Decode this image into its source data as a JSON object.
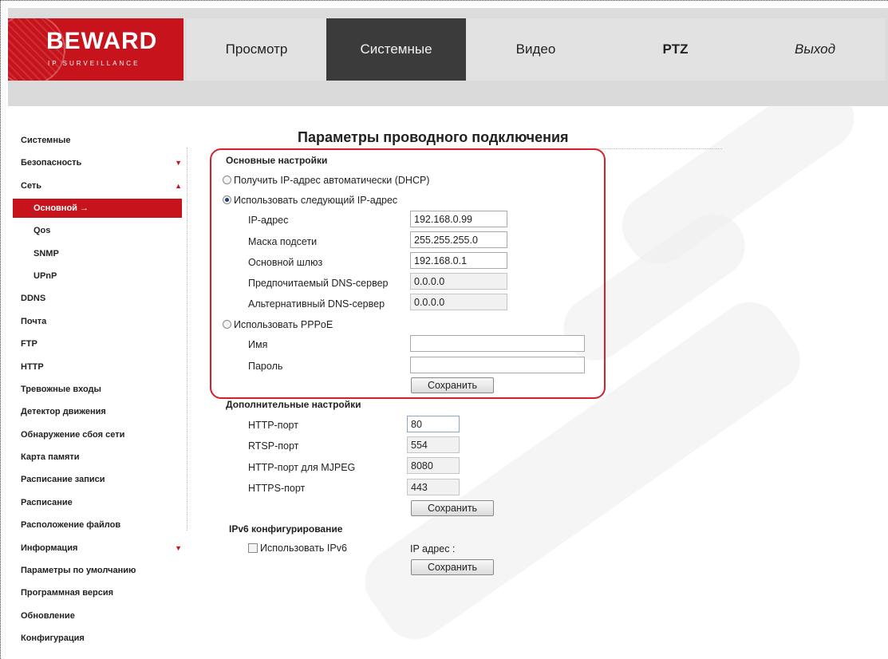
{
  "logo": {
    "brand": "BEWARD",
    "tagline": "IP SURVEILLANCE"
  },
  "nav": {
    "tabs": [
      {
        "label": "Просмотр"
      },
      {
        "label": "Системные"
      },
      {
        "label": "Видео"
      },
      {
        "label": "PTZ"
      },
      {
        "label": "Выход"
      }
    ]
  },
  "sidebar": {
    "items": [
      {
        "label": "Системные"
      },
      {
        "label": "Безопасность"
      },
      {
        "label": "Сеть"
      },
      {
        "label": "Основной"
      },
      {
        "label": "Qos"
      },
      {
        "label": "SNMP"
      },
      {
        "label": "UPnP"
      },
      {
        "label": "DDNS"
      },
      {
        "label": "Почта"
      },
      {
        "label": "FTP"
      },
      {
        "label": "HTTP"
      },
      {
        "label": "Тревожные входы"
      },
      {
        "label": "Детектор движения"
      },
      {
        "label": "Обнаружение сбоя сети"
      },
      {
        "label": "Карта памяти"
      },
      {
        "label": "Расписание записи"
      },
      {
        "label": "Расписание"
      },
      {
        "label": "Расположение файлов"
      },
      {
        "label": "Информация"
      },
      {
        "label": "Параметры по умолчанию"
      },
      {
        "label": "Программная версия"
      },
      {
        "label": "Обновление"
      },
      {
        "label": "Конфигурация"
      }
    ],
    "selected_arrow": "→",
    "expand_arrow_down": "▼",
    "expand_arrow_up": "▲"
  },
  "page": {
    "title": "Параметры проводного подключения"
  },
  "basic": {
    "heading": "Основные настройки",
    "dhcp_label": "Получить IP-адрес автоматически (DHCP)",
    "static_label": "Использовать следующий IP-адрес",
    "ip_label": "IP-адрес",
    "ip_value": "192.168.0.99",
    "mask_label": "Маска подсети",
    "mask_value": "255.255.255.0",
    "gateway_label": "Основной шлюз",
    "gateway_value": "192.168.0.1",
    "dns1_label": "Предпочитаемый DNS-сервер",
    "dns1_value": "0.0.0.0",
    "dns2_label": "Альтернативный DNS-сервер",
    "dns2_value": "0.0.0.0",
    "pppoe_label": "Использовать PPPoE",
    "name_label": "Имя",
    "name_value": "",
    "password_label": "Пароль",
    "password_value": "",
    "save_label": "Сохранить",
    "selected_mode": "static"
  },
  "advanced": {
    "heading": "Дополнительные настройки",
    "http_label": "HTTP-порт",
    "http_value": "80",
    "rtsp_label": "RTSP-порт",
    "rtsp_value": "554",
    "mjpeg_label": "HTTP-порт для MJPEG",
    "mjpeg_value": "8080",
    "https_label": "HTTPS-порт",
    "https_value": "443",
    "save_label": "Сохранить"
  },
  "ipv6": {
    "heading": "IPv6 конфигурирование",
    "use_label": "Использовать IPv6",
    "use_checked": false,
    "address_label": "IP адрес :",
    "save_label": "Сохранить"
  },
  "colors": {
    "accent": "#c7131c",
    "active_tab": "#3b3b3b",
    "highlight_border": "#d6202b"
  }
}
